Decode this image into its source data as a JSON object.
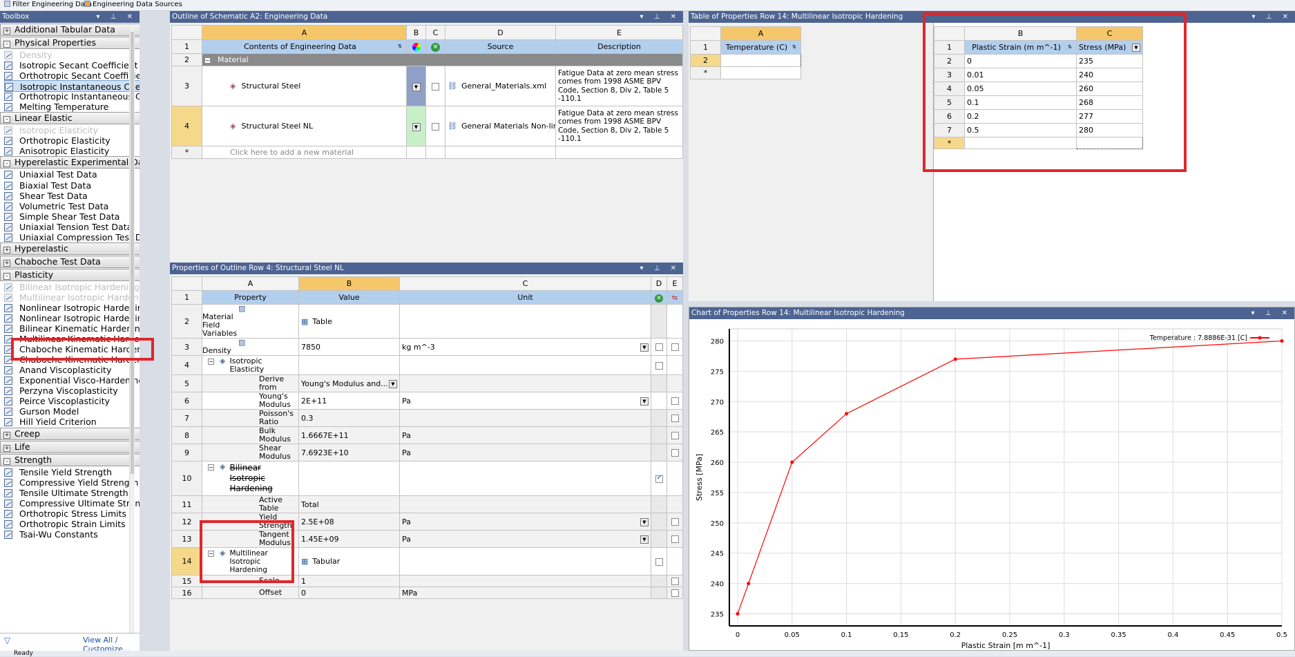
{
  "topbar": {
    "filter_label": "Filter Engineering Data",
    "sources_label": "Engineering Data Sources"
  },
  "toolbox": {
    "title": "Toolbox",
    "view_all": "View All / Customize...",
    "sections": [
      {
        "label": "Additional Tabular Data",
        "sign": "+"
      },
      {
        "label": "Physical Properties",
        "sign": "-"
      },
      {
        "label": "Linear Elastic",
        "sign": "-"
      },
      {
        "label": "Hyperelastic Experimental Data",
        "sign": "-"
      },
      {
        "label": "Hyperelastic",
        "sign": "+"
      },
      {
        "label": "Chaboche Test Data",
        "sign": "+"
      },
      {
        "label": "Plasticity",
        "sign": "-"
      },
      {
        "label": "Creep",
        "sign": "+"
      },
      {
        "label": "Life",
        "sign": "+"
      },
      {
        "label": "Strength",
        "sign": "-"
      }
    ],
    "items": [
      "Density",
      "Isotropic Secant Coefficient of T",
      "Orthotropic Secant Coefficient of",
      "Isotropic Instantaneous Coefficie",
      "Orthotropic Instantaneous Coeff",
      "Melting Temperature",
      "Isotropic Elasticity",
      "Orthotropic Elasticity",
      "Anisotropic Elasticity",
      "Uniaxial Test Data",
      "Biaxial Test Data",
      "Shear Test Data",
      "Volumetric Test Data",
      "Simple Shear Test Data",
      "Uniaxial Tension Test Data",
      "Uniaxial Compression Test Data",
      "Bilinear Isotropic Hardening",
      "Multilinear Isotropic Hardening",
      "Nonlinear Isotropic Hardening Po",
      "Nonlinear Isotropic Hardening Vo",
      "Bilinear Kinematic Hardening",
      "Multilinear Kinematic Hardening",
      "Chaboche Kinematic Hardening",
      "Chaboche Kinematic Hardening w",
      "Anand Viscoplasticity",
      "Exponential Visco-Hardening (EV",
      "Perzyna Viscoplasticity",
      "Peirce Viscoplasticity",
      "Gurson Model",
      "Hill Yield Criterion",
      "Tensile Yield Strength",
      "Compressive Yield Strength",
      "Tensile Ultimate Strength",
      "Compressive Ultimate Strength",
      "Orthotropic Stress Limits",
      "Orthotropic Strain Limits",
      "Tsai-Wu Constants"
    ]
  },
  "outline": {
    "title": "Outline of Schematic A2: Engineering Data",
    "cols": [
      "A",
      "B",
      "C",
      "D",
      "E"
    ],
    "headers": {
      "contents": "Contents of Engineering Data",
      "source": "Source",
      "description": "Description"
    },
    "rows": {
      "r1": "1",
      "r2": "2",
      "r3": "3",
      "r4": "4",
      "rstar": "*"
    },
    "group": "Material",
    "materials": [
      {
        "name": "Structural Steel",
        "source": "General_Materials.xml",
        "desc": [
          "Fatigue Data at zero mean stress",
          "comes from 1998 ASME BPV",
          "Code, Section 8, Div 2, Table 5",
          "-110.1"
        ]
      },
      {
        "name": "Structural Steel NL",
        "source": "General Materials Non-linea",
        "desc": [
          "Fatigue Data at zero mean stress",
          "comes from 1998 ASME BPV",
          "Code, Section 8, Div 2, Table 5",
          "-110.1"
        ]
      }
    ],
    "add_new": "Click here to add a new material"
  },
  "props": {
    "title": "Properties of Outline Row 4: Structural Steel NL",
    "cols": [
      "A",
      "B",
      "C",
      "D",
      "E"
    ],
    "headers": {
      "property": "Property",
      "value": "Value",
      "unit": "Unit"
    },
    "rows": [
      {
        "n": "1"
      },
      {
        "n": "2",
        "prop": "Material Field Variables",
        "val": "Table",
        "unit": ""
      },
      {
        "n": "3",
        "prop": "Density",
        "val": "7850",
        "unit": "kg m^-3"
      },
      {
        "n": "4",
        "prop": "Isotropic Elasticity",
        "val": "",
        "unit": ""
      },
      {
        "n": "5",
        "prop": "Derive from",
        "val": "Young's Modulus and...",
        "unit": ""
      },
      {
        "n": "6",
        "prop": "Young's Modulus",
        "val": "2E+11",
        "unit": "Pa"
      },
      {
        "n": "7",
        "prop": "Poisson's Ratio",
        "val": "0.3",
        "unit": ""
      },
      {
        "n": "8",
        "prop": "Bulk Modulus",
        "val": "1.6667E+11",
        "unit": "Pa"
      },
      {
        "n": "9",
        "prop": "Shear Modulus",
        "val": "7.6923E+10",
        "unit": "Pa"
      },
      {
        "n": "10",
        "prop": "Bilinear Isotropic Hardening",
        "val": "",
        "unit": ""
      },
      {
        "n": "11",
        "prop": "Active Table",
        "val": "Total",
        "unit": ""
      },
      {
        "n": "12",
        "prop": "Yield Strength",
        "val": "2.5E+08",
        "unit": "Pa"
      },
      {
        "n": "13",
        "prop": "Tangent Modulus",
        "val": "1.45E+09",
        "unit": "Pa"
      },
      {
        "n": "14",
        "prop": "Multilinear Isotropic Hardening",
        "val": "Tabular",
        "unit": ""
      },
      {
        "n": "15",
        "prop": "Scale",
        "val": "1",
        "unit": ""
      },
      {
        "n": "16",
        "prop": "Offset",
        "val": "0",
        "unit": "MPa"
      }
    ]
  },
  "table": {
    "title": "Table of Properties Row 14: Multilinear Isotropic Hardening",
    "left": {
      "col": "A",
      "hdr": "Temperature (C)",
      "rows": [
        "1",
        "2",
        "*"
      ]
    },
    "right": {
      "colB": "B",
      "colC": "C",
      "hdrB": "Plastic Strain (m m^-1)",
      "hdrC": "Stress (MPa)",
      "rows": [
        {
          "n": "2",
          "b": "0",
          "c": "235"
        },
        {
          "n": "3",
          "b": "0.01",
          "c": "240"
        },
        {
          "n": "4",
          "b": "0.05",
          "c": "260"
        },
        {
          "n": "5",
          "b": "0.1",
          "c": "268"
        },
        {
          "n": "6",
          "b": "0.2",
          "c": "277"
        },
        {
          "n": "7",
          "b": "0.5",
          "c": "280"
        }
      ],
      "r1": "1",
      "rstar": "*"
    }
  },
  "chart": {
    "title": "Chart of Properties Row 14: Multilinear Isotropic Hardening",
    "legend": "Temperature : 7.8886E-31 [C]",
    "color": "#ff0000"
  },
  "chart_data": {
    "type": "line",
    "x": [
      0,
      0.01,
      0.05,
      0.1,
      0.2,
      0.5
    ],
    "series": [
      {
        "name": "Temperature : 7.8886E-31 [C]",
        "values": [
          235,
          240,
          260,
          268,
          277,
          280
        ]
      }
    ],
    "xlabel": "Plastic Strain  [m m^-1]",
    "ylabel": "Stress  [MPa]",
    "xlim": [
      0,
      0.5
    ],
    "ylim": [
      233,
      282
    ],
    "xticks": [
      "0",
      "0.05",
      "0.1",
      "0.15",
      "0.2",
      "0.25",
      "0.3",
      "0.35",
      "0.4",
      "0.45",
      "0.5"
    ],
    "yticks": [
      "235",
      "240",
      "245",
      "250",
      "255",
      "260",
      "265",
      "270",
      "275",
      "280"
    ],
    "grid": true,
    "legend_position": "top-right"
  },
  "status": {
    "text": "Ready"
  }
}
